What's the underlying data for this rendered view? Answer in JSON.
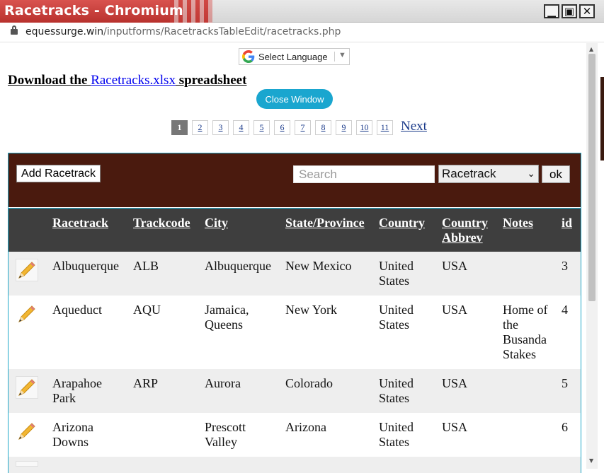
{
  "window": {
    "title": "Racetracks - Chromium",
    "minimize_glyph": "▁",
    "maximize_glyph": "▣",
    "close_glyph": "✕"
  },
  "address": {
    "host": "equessurge.win",
    "path": "/inputforms/RacetracksTableEdit/racetracks.php"
  },
  "translate": {
    "label": "Select Language",
    "arrow": "▼"
  },
  "download": {
    "prefix": "Download the ",
    "link": "Racetracks.xlsx",
    "suffix": " spreadsheet"
  },
  "close_window": "Close Window",
  "pagination": {
    "pages": [
      "1",
      "2",
      "3",
      "4",
      "5",
      "6",
      "7",
      "8",
      "9",
      "10",
      "11"
    ],
    "active": "1",
    "next": "Next"
  },
  "toolbar": {
    "add_label": "Add Racetrack",
    "search_placeholder": "Search",
    "select_value": "Racetrack",
    "ok_label": "ok"
  },
  "table": {
    "headers": [
      "Racetrack",
      "Trackcode",
      "City",
      "State/Province",
      "Country",
      "Country Abbrev",
      "Notes",
      "id"
    ],
    "rows": [
      {
        "racetrack": "Albuquerque",
        "trackcode": "ALB",
        "city": "Albuquerque",
        "state": "New Mexico",
        "country": "United States",
        "abbrev": "USA",
        "notes": "",
        "id": "3"
      },
      {
        "racetrack": "Aqueduct",
        "trackcode": "AQU",
        "city": "Jamaica, Queens",
        "state": "New York",
        "country": "United States",
        "abbrev": "USA",
        "notes": "Home of the Busanda Stakes",
        "id": "4"
      },
      {
        "racetrack": "Arapahoe Park",
        "trackcode": "ARP",
        "city": "Aurora",
        "state": "Colorado",
        "country": "United States",
        "abbrev": "USA",
        "notes": "",
        "id": "5"
      },
      {
        "racetrack": "Arizona Downs",
        "trackcode": "",
        "city": "Prescott Valley",
        "state": "Arizona",
        "country": "United States",
        "abbrev": "USA",
        "notes": "",
        "id": "6"
      }
    ]
  },
  "colors": {
    "toolbar_bg": "#4a1a0e",
    "header_bg": "#3e3e3e",
    "accent": "#1aa6cf",
    "titlebar": "#c0392b"
  }
}
